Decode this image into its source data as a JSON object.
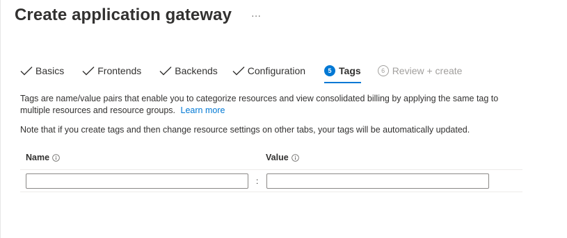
{
  "header": {
    "title": "Create application gateway",
    "more_label": "···"
  },
  "tabs": [
    {
      "label": "Basics",
      "state": "completed"
    },
    {
      "label": "Frontends",
      "state": "completed"
    },
    {
      "label": "Backends",
      "state": "completed"
    },
    {
      "label": "Configuration",
      "state": "completed"
    },
    {
      "label": "Tags",
      "state": "active",
      "step": "5"
    },
    {
      "label": "Review + create",
      "state": "disabled",
      "step": "6"
    }
  ],
  "description": {
    "text": "Tags are name/value pairs that enable you to categorize resources and view consolidated billing by applying the same tag to multiple resources and resource groups.",
    "link": "Learn more"
  },
  "note": "Note that if you create tags and then change resource settings on other tabs, your tags will be automatically updated.",
  "grid": {
    "name_header": "Name",
    "value_header": "Value",
    "separator": ":",
    "rows": [
      {
        "name": "",
        "value": ""
      }
    ]
  },
  "colors": {
    "accent": "#0078d4",
    "text": "#323130",
    "disabled": "#a19f9d"
  }
}
